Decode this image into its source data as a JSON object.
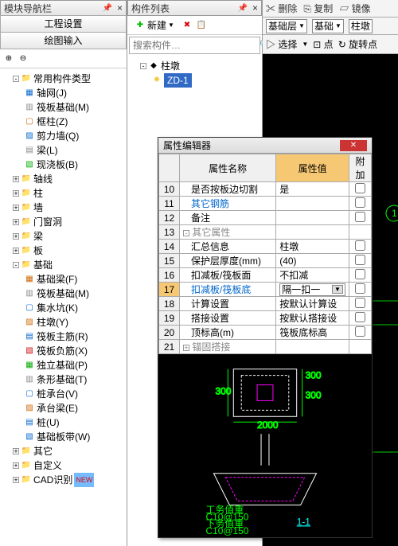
{
  "nav": {
    "title": "模块导航栏",
    "tab1": "工程设置",
    "tab2": "绘图输入",
    "root": "常用构件类型",
    "items": [
      "轴网(J)",
      "筏板基础(M)",
      "框柱(Z)",
      "剪力墙(Q)",
      "梁(L)",
      "现浇板(B)"
    ],
    "cats": [
      "轴线",
      "柱",
      "墙",
      "门窗洞",
      "梁",
      "板"
    ],
    "jichu": "基础",
    "jichu_items": [
      "基础梁(F)",
      "筏板基础(M)",
      "集水坑(K)",
      "柱墩(Y)",
      "筏板主筋(R)",
      "筏板负筋(X)",
      "独立基础(P)",
      "条形基础(T)",
      "桩承台(V)",
      "承台梁(E)",
      "桩(U)",
      "基础板带(W)"
    ],
    "other": [
      "其它",
      "自定义",
      "CAD识别"
    ],
    "new_badge": "NEW"
  },
  "list": {
    "title": "构件列表",
    "new_btn": "新建",
    "search_ph": "搜索构件…",
    "root": "柱墩",
    "item": "ZD-1"
  },
  "rt": {
    "del": "删除",
    "copy": "复制",
    "mirror": "镜像",
    "layer1": "基础层",
    "layer2": "基础",
    "layer3": "柱墩",
    "select": "选择",
    "point": "点",
    "rotate": "旋转点"
  },
  "prop": {
    "title": "属性编辑器",
    "h_name": "属性名称",
    "h_val": "属性值",
    "h_ext": "附加",
    "rows": [
      {
        "n": "10",
        "name": "是否按板边切割",
        "val": "是",
        "chk": true
      },
      {
        "n": "11",
        "name": "其它钢筋",
        "val": "",
        "chk": true,
        "blue": true
      },
      {
        "n": "12",
        "name": "备注",
        "val": "",
        "chk": true
      },
      {
        "n": "13",
        "name": "其它属性",
        "val": "",
        "group": true
      },
      {
        "n": "14",
        "name": "汇总信息",
        "val": "柱墩",
        "chk": true
      },
      {
        "n": "15",
        "name": "保护层厚度(mm)",
        "val": "(40)",
        "chk": true
      },
      {
        "n": "16",
        "name": "扣减板/筏板面",
        "val": "不扣减",
        "chk": true
      },
      {
        "n": "17",
        "name": "扣减板/筏板底",
        "val": "隔一扣一",
        "chk": true,
        "sel": true,
        "dd": true
      },
      {
        "n": "18",
        "name": "计算设置",
        "val": "按默认计算设",
        "chk": false
      },
      {
        "n": "19",
        "name": "搭接设置",
        "val": "按默认搭接设",
        "chk": false
      },
      {
        "n": "20",
        "name": "顶标高(m)",
        "val": "筏板底标高",
        "chk": true
      },
      {
        "n": "21",
        "name": "锚固搭接",
        "val": "",
        "group": true
      }
    ]
  },
  "diag": {
    "l1": "工务值重",
    "l2": "C10@150",
    "l3": "下务值重",
    "l4": "C10@150",
    "link": "1-1"
  }
}
